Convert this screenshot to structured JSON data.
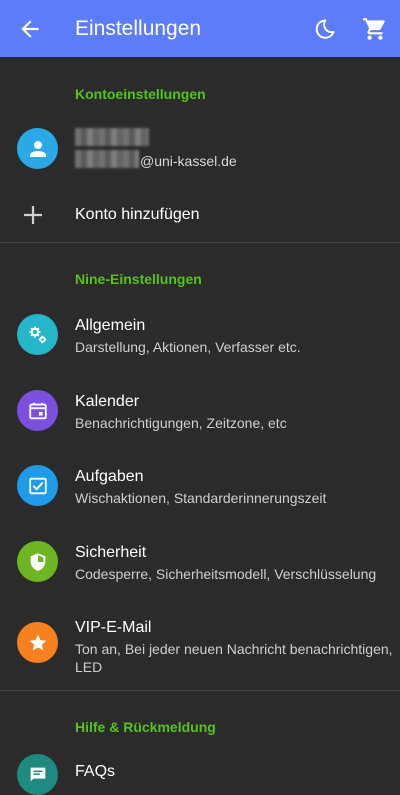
{
  "appbar": {
    "title": "Einstellungen"
  },
  "sections": {
    "account": "Kontoeinstellungen",
    "nine": "Nine-Einstellungen",
    "help": "Hilfe & Rückmeldung"
  },
  "account": {
    "email_suffix": "@uni-kassel.de",
    "add_account": "Konto hinzufügen"
  },
  "items": [
    {
      "title": "Allgemein",
      "subtitle": "Darstellung, Aktionen, Verfasser etc.",
      "color": "#26b6c9"
    },
    {
      "title": "Kalender",
      "subtitle": "Benachrichtigungen, Zeitzone, etc",
      "color": "#7b4fe0"
    },
    {
      "title": "Aufgaben",
      "subtitle": "Wischaktionen, Standarderinnerungszeit",
      "color": "#1e9be9"
    },
    {
      "title": "Sicherheit",
      "subtitle": "Codesperre, Sicherheitsmodell, Verschlüsselung",
      "color": "#6fb523"
    },
    {
      "title": "VIP-E-Mail",
      "subtitle": "Ton an, Bei jeder neuen Nachricht benachrichtigen, LED",
      "color": "#f5821f"
    }
  ],
  "help_items": [
    {
      "title": "FAQs",
      "color": "#1f8a80"
    }
  ],
  "colors": {
    "appbar": "#5c7cfa",
    "background": "#2b2b2b",
    "section": "#52c41a",
    "avatar": "#29a9e6"
  }
}
